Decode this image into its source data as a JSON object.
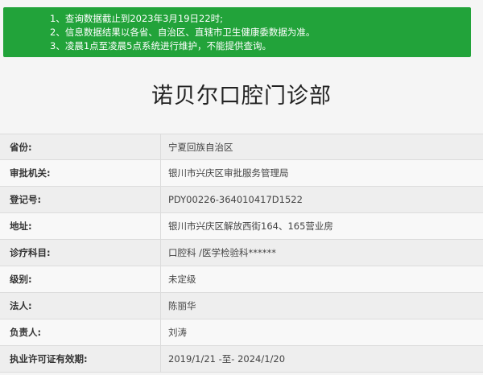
{
  "notice": {
    "lines": [
      "1、查询数据截止到2023年3月19日22时;",
      "2、信息数据结果以各省、自治区、直辖市卫生健康委数据为准。",
      "3、凌晨1点至凌晨5点系统进行维护，不能提供查询。"
    ],
    "background_color": "#22a33a"
  },
  "clinic": {
    "title": "诺贝尔口腔门诊部"
  },
  "details": [
    {
      "label": "省份:",
      "value": "宁夏回族自治区"
    },
    {
      "label": "审批机关:",
      "value": "银川市兴庆区审批服务管理局"
    },
    {
      "label": "登记号:",
      "value": "PDY00226-364010417D1522"
    },
    {
      "label": "地址:",
      "value": "银川市兴庆区解放西街164、165营业房"
    },
    {
      "label": "诊疗科目:",
      "value": "口腔科 /医学检验科******"
    },
    {
      "label": "级别:",
      "value": "未定级"
    },
    {
      "label": "法人:",
      "value": "陈丽华"
    },
    {
      "label": "负责人:",
      "value": "刘涛"
    },
    {
      "label": "执业许可证有效期:",
      "value": "2019/1/21 -至- 2024/1/20"
    }
  ]
}
